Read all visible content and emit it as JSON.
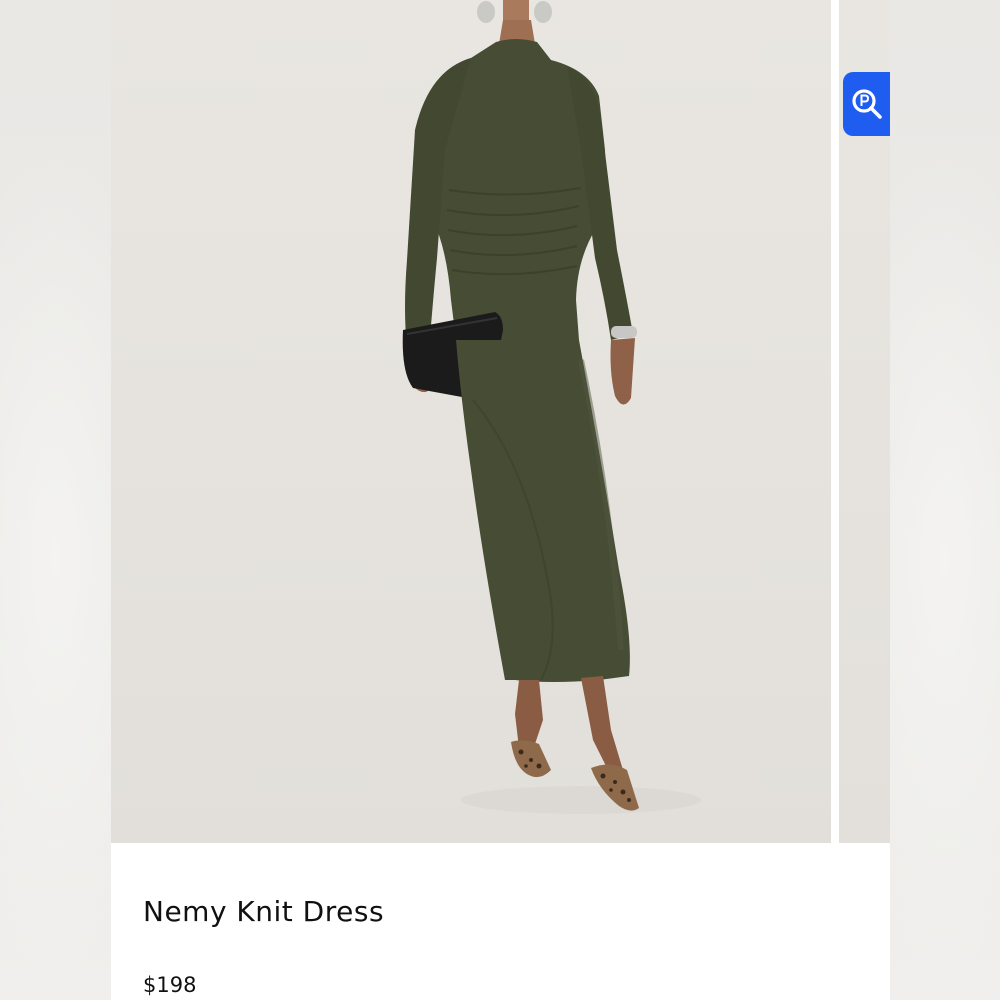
{
  "product": {
    "name": "Nemy Knit Dress",
    "price": "$198",
    "image_description": "model wearing olive green long-sleeve ruched knit maxi dress, holding black clutch, leopard print heels"
  },
  "colors": {
    "dress": "#474d34",
    "background": "#e6e3de",
    "lens_button": "#1f5cf0"
  },
  "icons": {
    "visual_search": "lens-search-icon"
  }
}
